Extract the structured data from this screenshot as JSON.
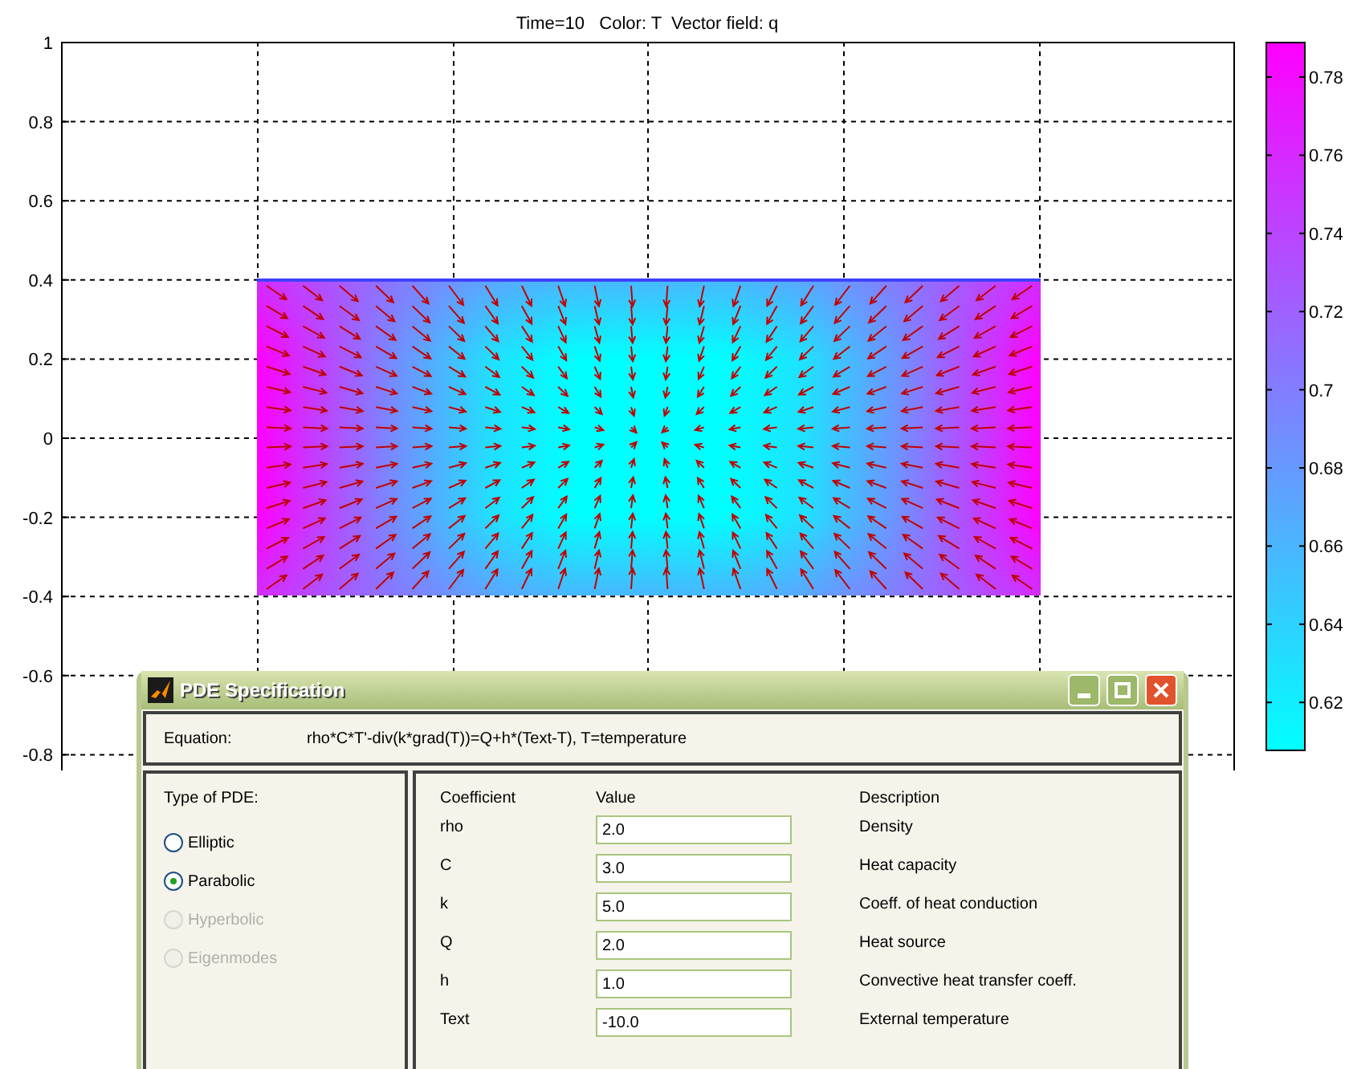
{
  "plot": {
    "title": "Time=10   Color: T  Vector field: q",
    "yticks": [
      "1",
      "0.8",
      "0.6",
      "0.4",
      "0.2",
      "0",
      "-0.2",
      "-0.4",
      "-0.6",
      "-0.8"
    ]
  },
  "colorbar": {
    "ticks": [
      "0.78",
      "0.76",
      "0.74",
      "0.72",
      "0.7",
      "0.68",
      "0.66",
      "0.64",
      "0.62"
    ]
  },
  "dialog": {
    "title": "PDE Specification",
    "equation_label": "Equation:",
    "equation": "rho*C*T'-div(k*grad(T))=Q+h*(Text-T), T=temperature",
    "type_label": "Type of PDE:",
    "types": [
      {
        "label": "Elliptic",
        "selected": false,
        "disabled": false
      },
      {
        "label": "Parabolic",
        "selected": true,
        "disabled": false
      },
      {
        "label": "Hyperbolic",
        "selected": false,
        "disabled": true
      },
      {
        "label": "Eigenmodes",
        "selected": false,
        "disabled": true
      }
    ],
    "columns": [
      "Coefficient",
      "Value",
      "Description"
    ],
    "rows": [
      {
        "coefficient": "rho",
        "value": "2.0",
        "description": "Density"
      },
      {
        "coefficient": "C",
        "value": "3.0",
        "description": "Heat capacity"
      },
      {
        "coefficient": "k",
        "value": "5.0",
        "description": "Coeff. of heat conduction"
      },
      {
        "coefficient": "Q",
        "value": "2.0",
        "description": "Heat source"
      },
      {
        "coefficient": "h",
        "value": "1.0",
        "description": "Convective heat transfer coeff."
      },
      {
        "coefficient": "Text",
        "value": "-10.0",
        "description": "External temperature"
      }
    ]
  }
}
